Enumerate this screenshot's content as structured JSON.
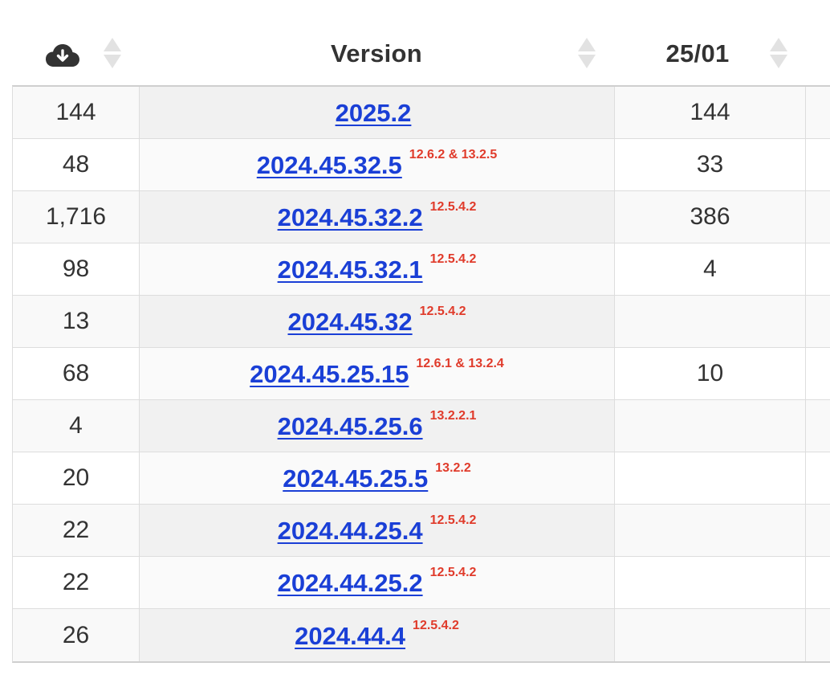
{
  "header": {
    "downloads_icon": "cloud-download-icon",
    "version_label": "Version",
    "date_label": "25/01"
  },
  "rows": [
    {
      "downloads": "144",
      "version": "2025.2",
      "note": "",
      "date_count": "144"
    },
    {
      "downloads": "48",
      "version": "2024.45.32.5",
      "note": "12.6.2 & 13.2.5",
      "date_count": "33"
    },
    {
      "downloads": "1,716",
      "version": "2024.45.32.2",
      "note": "12.5.4.2",
      "date_count": "386"
    },
    {
      "downloads": "98",
      "version": "2024.45.32.1",
      "note": "12.5.4.2",
      "date_count": "4"
    },
    {
      "downloads": "13",
      "version": "2024.45.32",
      "note": "12.5.4.2",
      "date_count": ""
    },
    {
      "downloads": "68",
      "version": "2024.45.25.15",
      "note": "12.6.1 & 13.2.4",
      "date_count": "10"
    },
    {
      "downloads": "4",
      "version": "2024.45.25.6",
      "note": "13.2.2.1",
      "date_count": ""
    },
    {
      "downloads": "20",
      "version": "2024.45.25.5",
      "note": "13.2.2",
      "date_count": ""
    },
    {
      "downloads": "22",
      "version": "2024.44.25.4",
      "note": "12.5.4.2",
      "date_count": ""
    },
    {
      "downloads": "22",
      "version": "2024.44.25.2",
      "note": "12.5.4.2",
      "date_count": ""
    },
    {
      "downloads": "26",
      "version": "2024.44.4",
      "note": "12.5.4.2",
      "date_count": ""
    }
  ],
  "colors": {
    "link": "#1a3fd6",
    "note": "#e03b2b",
    "text": "#333333",
    "sort_arrow": "#e2e2e2"
  }
}
